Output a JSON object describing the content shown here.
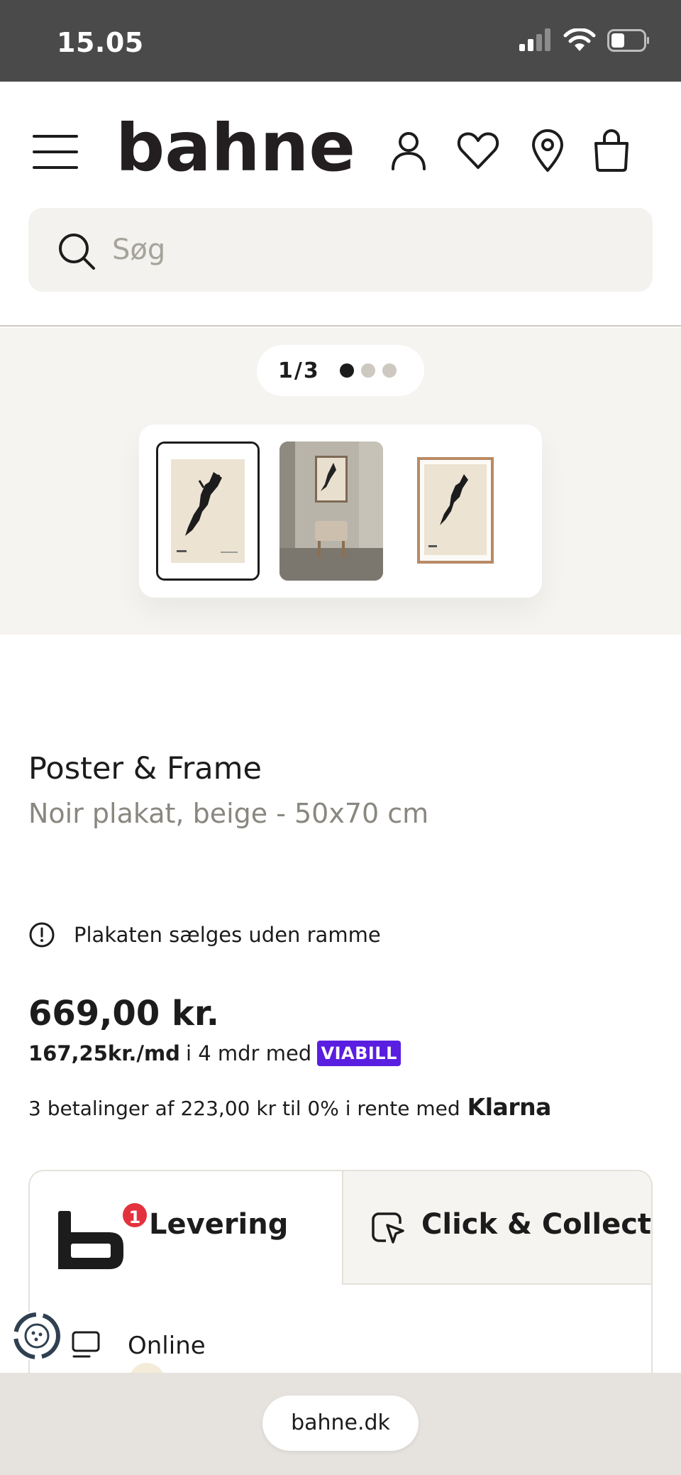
{
  "status_bar": {
    "time": "15.05",
    "battery_percent": 35
  },
  "header": {
    "logo_text": "bahne"
  },
  "search": {
    "placeholder": "Søg"
  },
  "gallery": {
    "pager_text": "1/3",
    "pages": 3,
    "current_page": 1,
    "thumb_count": 3
  },
  "product": {
    "brand": "Poster & Frame",
    "name": "Noir plakat, beige - 50x70 cm",
    "notice": "Plakaten sælges uden ramme",
    "price": "669,00 kr.",
    "viabill": {
      "amount": "167,25kr./md",
      "text": "i 4 mdr med",
      "badge": "VIABILL"
    },
    "klarna": {
      "text": "3 betalinger af 223,00 kr til 0% i rente med",
      "logo": "Klarna"
    }
  },
  "delivery": {
    "tabs": [
      {
        "label": "Levering",
        "badge": "1",
        "active": true
      },
      {
        "label": "Click & Collect",
        "active": false
      }
    ],
    "online_label": "Online"
  },
  "browser": {
    "url": "bahne.dk"
  },
  "colors": {
    "viabill": "#5a1ee0",
    "badge_red": "#e3323d",
    "surface": "#f3f2ee"
  }
}
